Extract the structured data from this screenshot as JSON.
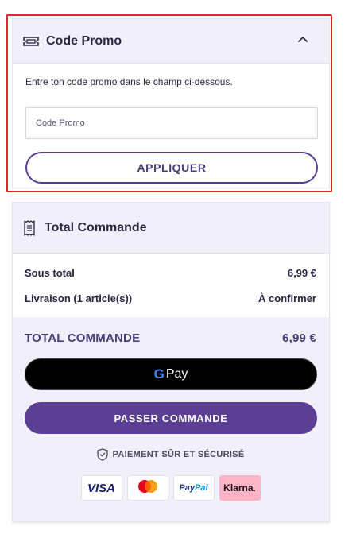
{
  "promo": {
    "title": "Code Promo",
    "description": "Entre ton code promo dans le champ ci-dessous.",
    "input_placeholder": "Code Promo",
    "apply_label": "APPLIQUER"
  },
  "total": {
    "title": "Total Commande",
    "rows": [
      {
        "label": "Sous total",
        "value": "6,99 €"
      },
      {
        "label": "Livraison (1 article(s))",
        "value": "À confirmer"
      }
    ],
    "grand_label": "TOTAL COMMANDE",
    "grand_value": "6,99 €",
    "gpay_g": "G",
    "gpay_label": "Pay",
    "order_label": "PASSER COMMANDE",
    "secure_label": "PAIEMENT SÛR ET SÉCURISÉ",
    "badges": {
      "visa": "VISA",
      "mastercard": "mastercard",
      "paypal_a": "Pay",
      "paypal_b": "Pal",
      "klarna": "Klarna."
    }
  },
  "colors": {
    "accent": "#5b3f95",
    "highlight": "#e3242b",
    "panel": "#f1f0fa"
  },
  "icons": {
    "promo": "ticket-icon",
    "collapse": "chevron-up-icon",
    "total": "receipt-icon",
    "secure": "shield-check-icon"
  }
}
